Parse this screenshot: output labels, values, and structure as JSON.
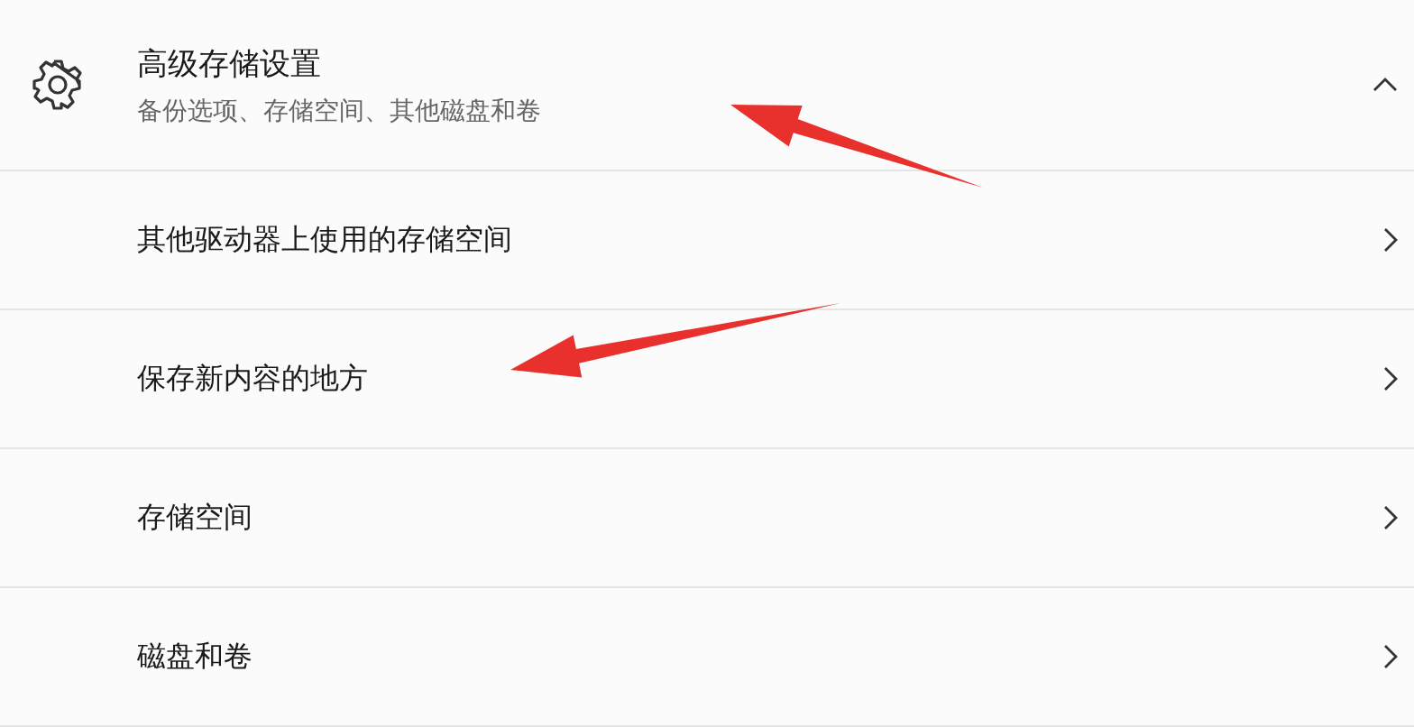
{
  "section": {
    "title": "高级存储设置",
    "subtitle": "备份选项、存储空间、其他磁盘和卷",
    "expanded": true
  },
  "items": [
    {
      "label": "其他驱动器上使用的存储空间"
    },
    {
      "label": "保存新内容的地方"
    },
    {
      "label": "存储空间"
    },
    {
      "label": "磁盘和卷"
    }
  ],
  "annotations": [
    {
      "kind": "arrow"
    },
    {
      "kind": "arrow"
    }
  ]
}
